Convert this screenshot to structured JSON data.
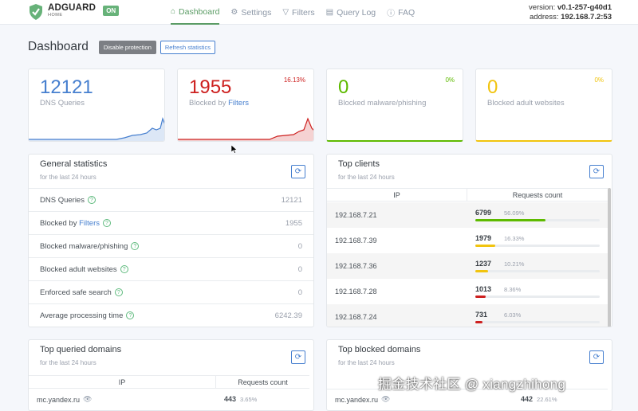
{
  "header": {
    "brand": "ADGUARD",
    "brand_sub": "HOME",
    "status_badge": "ON",
    "nav": [
      {
        "label": "Dashboard",
        "icon": "home-icon"
      },
      {
        "label": "Settings",
        "icon": "gear-icon"
      },
      {
        "label": "Filters",
        "icon": "filter-icon"
      },
      {
        "label": "Query Log",
        "icon": "document-icon"
      },
      {
        "label": "FAQ",
        "icon": "help-icon"
      }
    ],
    "version_label": "version:",
    "version": "v0.1-257-g40d1",
    "address_label": "address:",
    "address": "192.168.7.2:53"
  },
  "page": {
    "title": "Dashboard",
    "disable_btn": "Disable protection",
    "refresh_btn": "Refresh statistics"
  },
  "stats": [
    {
      "value": "12121",
      "label": "DNS Queries",
      "percent": "",
      "color": "#467fcf"
    },
    {
      "value": "1955",
      "label": "Blocked by ",
      "label_link": "Filters",
      "percent": "16.13%",
      "color": "#cd201f"
    },
    {
      "value": "0",
      "label": "Blocked malware/phishing",
      "percent": "0%",
      "color": "#5eba00"
    },
    {
      "value": "0",
      "label": "Blocked adult websites",
      "percent": "0%",
      "color": "#f1c40f"
    }
  ],
  "general": {
    "title": "General statistics",
    "subtitle": "for the last 24 hours",
    "rows": [
      {
        "label": "DNS Queries",
        "value": "12121"
      },
      {
        "label": "Blocked by ",
        "link": "Filters",
        "value": "1955"
      },
      {
        "label": "Blocked malware/phishing",
        "value": "0"
      },
      {
        "label": "Blocked adult websites",
        "value": "0"
      },
      {
        "label": "Enforced safe search",
        "value": "0"
      },
      {
        "label": "Average processing time",
        "value": "6242.39"
      }
    ]
  },
  "clients": {
    "title": "Top clients",
    "subtitle": "for the last 24 hours",
    "col_ip": "IP",
    "col_count": "Requests count",
    "rows": [
      {
        "ip": "192.168.7.21",
        "count": "6799",
        "percent": "56.09%",
        "fraction": 0.5609,
        "color": "#5eba00"
      },
      {
        "ip": "192.168.7.39",
        "count": "1979",
        "percent": "16.33%",
        "fraction": 0.1633,
        "color": "#f1c40f"
      },
      {
        "ip": "192.168.7.36",
        "count": "1237",
        "percent": "10.21%",
        "fraction": 0.1021,
        "color": "#f1c40f"
      },
      {
        "ip": "192.168.7.28",
        "count": "1013",
        "percent": "8.36%",
        "fraction": 0.0836,
        "color": "#cd201f"
      },
      {
        "ip": "192.168.7.24",
        "count": "731",
        "percent": "6.03%",
        "fraction": 0.0603,
        "color": "#cd201f"
      }
    ]
  },
  "queried": {
    "title": "Top queried domains",
    "subtitle": "for the last 24 hours",
    "col_ip": "IP",
    "col_count": "Requests count",
    "row": {
      "domain": "mc.yandex.ru",
      "count": "443",
      "percent": "3.65%"
    }
  },
  "blocked": {
    "title": "Top blocked domains",
    "subtitle": "for the last 24 hours",
    "row": {
      "domain": "mc.yandex.ru",
      "count": "442",
      "percent": "22.61%"
    }
  },
  "watermark": "掘金技术社区 @ xiangzhihong"
}
